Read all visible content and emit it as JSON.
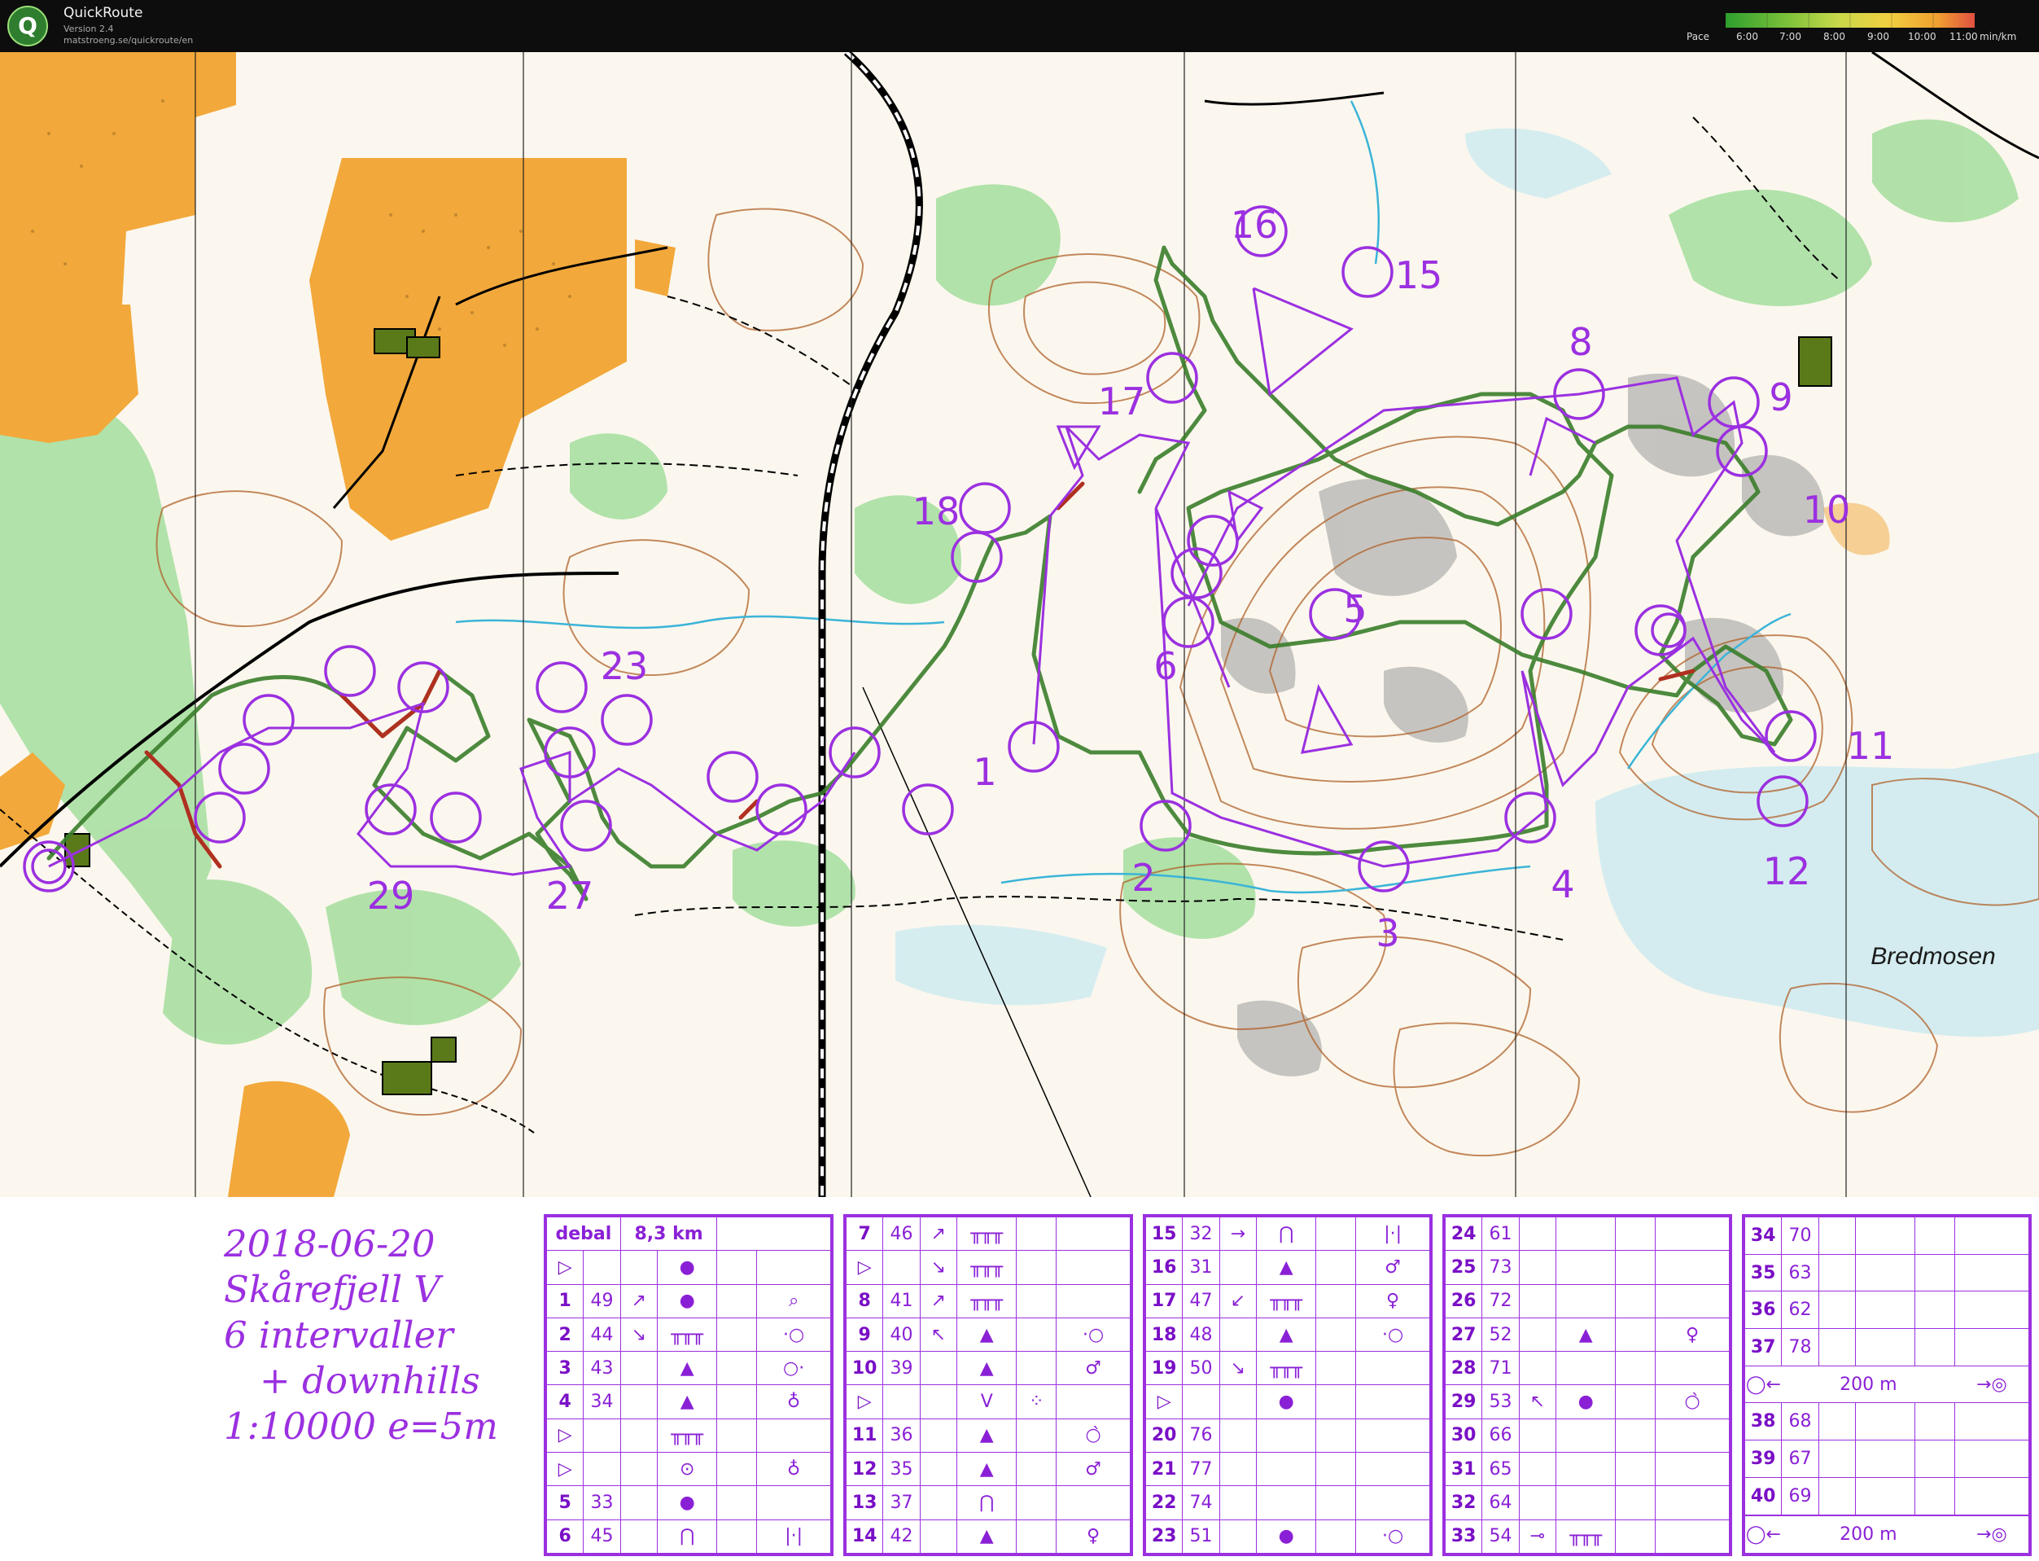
{
  "app": {
    "name": "QuickRoute",
    "version": "Version 2.4",
    "url": "matstroeng.se/quickroute/en",
    "logo_letter": "Q"
  },
  "pace_legend": {
    "label": "Pace",
    "ticks": [
      "6:00",
      "7:00",
      "8:00",
      "9:00",
      "10:00",
      "11:00"
    ],
    "unit": "min/km",
    "colors": [
      "#2e9e2e",
      "#7dc23a",
      "#c8d84a",
      "#f0d040",
      "#f0a030",
      "#e05040"
    ]
  },
  "map": {
    "place_name": "Bredmosen",
    "control_labels": [
      "1",
      "2",
      "3",
      "4",
      "5",
      "6",
      "8",
      "9",
      "10",
      "11",
      "12",
      "15",
      "16",
      "17",
      "18",
      "23",
      "27",
      "29"
    ],
    "colors": {
      "course": "#9b30e0",
      "route": "#3a7d2a",
      "route_slow": "#b03020",
      "open_land": "#f2a83a",
      "forest_green": "#6cc36a",
      "contour": "#b0622a",
      "water": "#3bb4d8",
      "rock": "#9a9a9a"
    }
  },
  "title_block": {
    "line1": "2018-06-20",
    "line2": "Skårefjell V",
    "line3": "6 intervaller",
    "line4": "+ downhills",
    "line5": "1:10000 e=5m"
  },
  "description_columns": [
    {
      "rows": [
        [
          "debal",
          "",
          "8,3 km",
          "",
          "",
          ""
        ],
        [
          "▷",
          "",
          "",
          "●",
          "",
          ""
        ],
        [
          "1",
          "49",
          "↗",
          "●",
          "",
          "⌕"
        ],
        [
          "2",
          "44",
          "↘",
          "╥╥╥",
          "",
          "·○"
        ],
        [
          "3",
          "43",
          "",
          "▲",
          "",
          "○·"
        ],
        [
          "4",
          "34",
          "",
          "▲",
          "",
          "♁"
        ],
        [
          "▷",
          "",
          "",
          "╥╥╥",
          "",
          ""
        ],
        [
          "▷",
          "",
          "",
          "⊙",
          "",
          "♁"
        ],
        [
          "5",
          "33",
          "",
          "●",
          "",
          ""
        ],
        [
          "6",
          "45",
          "",
          "⋂",
          "",
          "|·|"
        ]
      ]
    },
    {
      "rows": [
        [
          "7",
          "46",
          "↗",
          "╥╥╥",
          "",
          ""
        ],
        [
          "▷",
          "",
          "↘",
          "╥╥╥",
          "",
          ""
        ],
        [
          "8",
          "41",
          "↗",
          "╥╥╥",
          "",
          ""
        ],
        [
          "9",
          "40",
          "↖",
          "▲",
          "",
          "·○"
        ],
        [
          "10",
          "39",
          "",
          "▲",
          "",
          "♂"
        ],
        [
          "▷",
          "",
          "",
          "V",
          "⁘",
          ""
        ],
        [
          "11",
          "36",
          "",
          "▲",
          "",
          "○̀"
        ],
        [
          "12",
          "35",
          "",
          "▲",
          "",
          "♂"
        ],
        [
          "13",
          "37",
          "",
          "⋂",
          "",
          ""
        ],
        [
          "14",
          "42",
          "",
          "▲",
          "",
          "♀"
        ]
      ]
    },
    {
      "rows": [
        [
          "15",
          "32",
          "→",
          "⋂",
          "",
          "|·|"
        ],
        [
          "16",
          "31",
          "",
          "▲",
          "",
          "♂"
        ],
        [
          "17",
          "47",
          "↙",
          "╥╥╥",
          "",
          "♀"
        ],
        [
          "18",
          "48",
          "",
          "▲",
          "",
          "·○"
        ],
        [
          "19",
          "50",
          "↘",
          "╥╥╥",
          "",
          ""
        ],
        [
          "▷",
          "",
          "",
          "●",
          "",
          ""
        ],
        [
          "20",
          "76",
          "",
          "",
          "",
          ""
        ],
        [
          "21",
          "77",
          "",
          "",
          "",
          ""
        ],
        [
          "22",
          "74",
          "",
          "",
          "",
          ""
        ],
        [
          "23",
          "51",
          "",
          "●",
          "",
          "·○"
        ]
      ]
    },
    {
      "rows": [
        [
          "24",
          "61",
          "",
          "",
          "",
          ""
        ],
        [
          "25",
          "73",
          "",
          "",
          "",
          ""
        ],
        [
          "26",
          "72",
          "",
          "",
          "",
          ""
        ],
        [
          "27",
          "52",
          "",
          "▲",
          "",
          "♀"
        ],
        [
          "28",
          "71",
          "",
          "",
          "",
          ""
        ],
        [
          "29",
          "53",
          "↖",
          "●",
          "",
          "○̀"
        ],
        [
          "30",
          "66",
          "",
          "",
          "",
          ""
        ],
        [
          "31",
          "65",
          "",
          "",
          "",
          ""
        ],
        [
          "32",
          "64",
          "",
          "",
          "",
          ""
        ],
        [
          "33",
          "54",
          "⊸",
          "╥╥╥",
          "",
          ""
        ]
      ]
    },
    {
      "rows": [
        [
          "34",
          "70",
          "",
          "",
          "",
          ""
        ],
        [
          "35",
          "63",
          "",
          "",
          "",
          ""
        ],
        [
          "36",
          "62",
          "",
          "",
          "",
          ""
        ],
        [
          "37",
          "78",
          "",
          "",
          "",
          ""
        ],
        [
          "◯←",
          "200 m",
          "→◎"
        ],
        [
          "38",
          "68",
          "",
          "",
          "",
          ""
        ],
        [
          "39",
          "67",
          "",
          "",
          "",
          ""
        ],
        [
          "40",
          "69",
          "",
          "",
          "",
          ""
        ],
        [
          "",
          "",
          "",
          "",
          "",
          ""
        ],
        [
          "◯←",
          "200 m",
          "→◎"
        ]
      ]
    }
  ]
}
